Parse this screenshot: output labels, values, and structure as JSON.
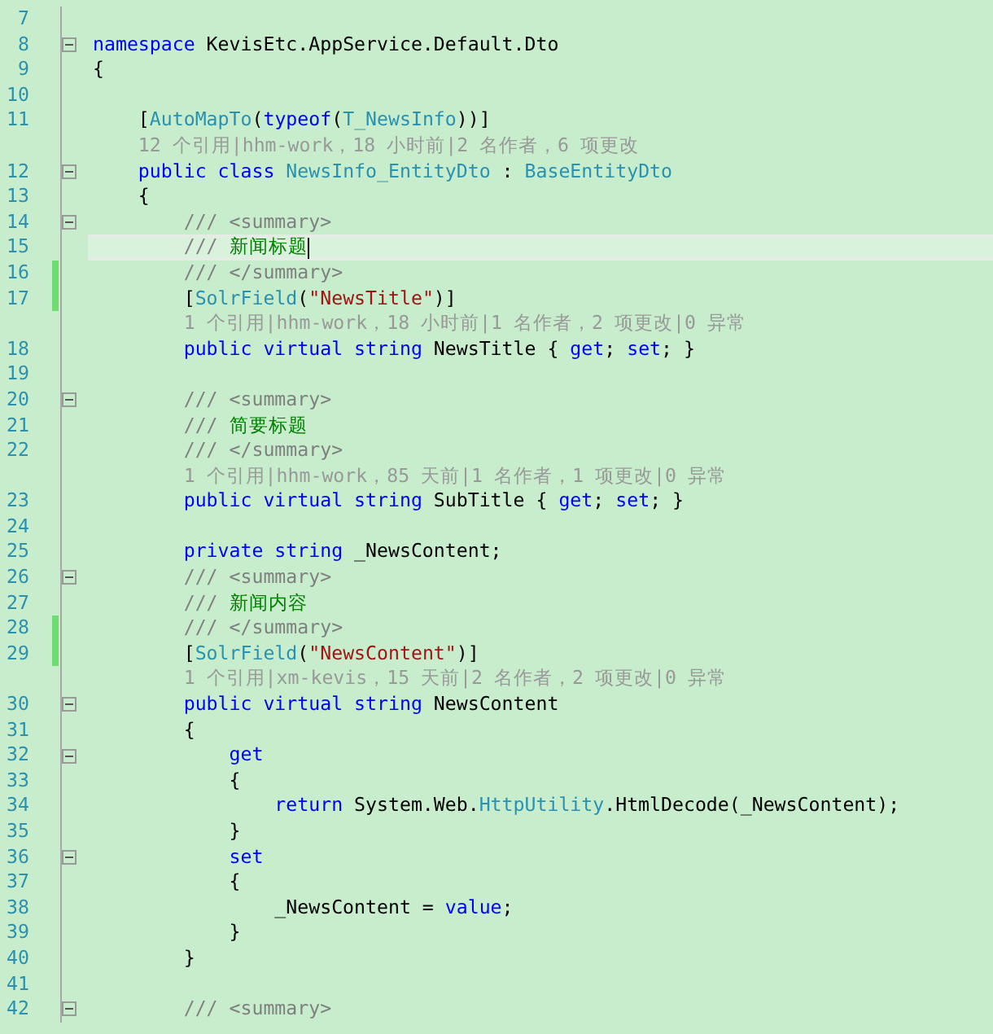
{
  "editor": {
    "lines": [
      {
        "num": "7",
        "kind": "code",
        "fold": false,
        "changed": false,
        "current": false
      },
      {
        "num": "8",
        "kind": "code",
        "fold": true,
        "changed": false,
        "current": false,
        "tokens": [
          {
            "kind": "kw",
            "text": "namespace"
          },
          {
            "kind": "plain",
            "text": " KevisEtc.AppService.Default.Dto"
          }
        ]
      },
      {
        "num": "9",
        "kind": "code",
        "fold": false,
        "changed": false,
        "current": false,
        "tokens": [
          {
            "kind": "plain",
            "text": "{"
          }
        ]
      },
      {
        "num": "10",
        "kind": "code",
        "fold": false,
        "changed": false,
        "current": false
      },
      {
        "num": "11",
        "kind": "code",
        "fold": false,
        "changed": false,
        "current": false,
        "tokens": [
          {
            "kind": "plain",
            "text": "    ["
          },
          {
            "kind": "type",
            "text": "AutoMapTo"
          },
          {
            "kind": "plain",
            "text": "("
          },
          {
            "kind": "kw",
            "text": "typeof"
          },
          {
            "kind": "plain",
            "text": "("
          },
          {
            "kind": "type",
            "text": "T_NewsInfo"
          },
          {
            "kind": "plain",
            "text": "))]"
          }
        ]
      },
      {
        "kind": "lens",
        "text": "    12 个引用|hhm-work，18 小时前|2 名作者，6 项更改"
      },
      {
        "num": "12",
        "kind": "code",
        "fold": true,
        "changed": false,
        "current": false,
        "tokens": [
          {
            "kind": "kw",
            "text": "    public class "
          },
          {
            "kind": "type",
            "text": "NewsInfo_EntityDto"
          },
          {
            "kind": "plain",
            "text": " : "
          },
          {
            "kind": "type",
            "text": "BaseEntityDto"
          }
        ]
      },
      {
        "num": "13",
        "kind": "code",
        "fold": false,
        "changed": false,
        "current": false,
        "tokens": [
          {
            "kind": "plain",
            "text": "    {"
          }
        ]
      },
      {
        "num": "14",
        "kind": "code",
        "fold": true,
        "changed": false,
        "current": false,
        "tokens": [
          {
            "kind": "doc",
            "text": "        /// <summary>"
          }
        ]
      },
      {
        "num": "15",
        "kind": "code",
        "fold": false,
        "changed": false,
        "current": true,
        "tokens": [
          {
            "kind": "doc",
            "text": "        /// "
          },
          {
            "kind": "comment",
            "text": "新闻标题"
          }
        ]
      },
      {
        "num": "16",
        "kind": "code",
        "fold": false,
        "changed": true,
        "current": false,
        "tokens": [
          {
            "kind": "doc",
            "text": "        /// </summary>"
          }
        ]
      },
      {
        "num": "17",
        "kind": "code",
        "fold": false,
        "changed": true,
        "current": false,
        "tokens": [
          {
            "kind": "plain",
            "text": "        ["
          },
          {
            "kind": "type",
            "text": "SolrField"
          },
          {
            "kind": "plain",
            "text": "("
          },
          {
            "kind": "str",
            "text": "\"NewsTitle\""
          },
          {
            "kind": "plain",
            "text": ")]"
          }
        ]
      },
      {
        "kind": "lens",
        "text": "        1 个引用|hhm-work，18 小时前|1 名作者，2 项更改|0 异常"
      },
      {
        "num": "18",
        "kind": "code",
        "fold": false,
        "changed": false,
        "current": false,
        "tokens": [
          {
            "kind": "kw",
            "text": "        public virtual string"
          },
          {
            "kind": "plain",
            "text": " NewsTitle { "
          },
          {
            "kind": "kw",
            "text": "get"
          },
          {
            "kind": "plain",
            "text": "; "
          },
          {
            "kind": "kw",
            "text": "set"
          },
          {
            "kind": "plain",
            "text": "; }"
          }
        ]
      },
      {
        "num": "19",
        "kind": "code",
        "fold": false,
        "changed": false,
        "current": false
      },
      {
        "num": "20",
        "kind": "code",
        "fold": true,
        "changed": false,
        "current": false,
        "tokens": [
          {
            "kind": "doc",
            "text": "        /// <summary>"
          }
        ]
      },
      {
        "num": "21",
        "kind": "code",
        "fold": false,
        "changed": false,
        "current": false,
        "tokens": [
          {
            "kind": "doc",
            "text": "        /// "
          },
          {
            "kind": "comment",
            "text": "简要标题"
          }
        ]
      },
      {
        "num": "22",
        "kind": "code",
        "fold": false,
        "changed": false,
        "current": false,
        "tokens": [
          {
            "kind": "doc",
            "text": "        /// </summary>"
          }
        ]
      },
      {
        "kind": "lens",
        "text": "        1 个引用|hhm-work，85 天前|1 名作者，1 项更改|0 异常"
      },
      {
        "num": "23",
        "kind": "code",
        "fold": false,
        "changed": false,
        "current": false,
        "tokens": [
          {
            "kind": "kw",
            "text": "        public virtual string"
          },
          {
            "kind": "plain",
            "text": " SubTitle { "
          },
          {
            "kind": "kw",
            "text": "get"
          },
          {
            "kind": "plain",
            "text": "; "
          },
          {
            "kind": "kw",
            "text": "set"
          },
          {
            "kind": "plain",
            "text": "; }"
          }
        ]
      },
      {
        "num": "24",
        "kind": "code",
        "fold": false,
        "changed": false,
        "current": false
      },
      {
        "num": "25",
        "kind": "code",
        "fold": false,
        "changed": false,
        "current": false,
        "tokens": [
          {
            "kind": "kw",
            "text": "        private string"
          },
          {
            "kind": "plain",
            "text": " _NewsContent;"
          }
        ]
      },
      {
        "num": "26",
        "kind": "code",
        "fold": true,
        "changed": false,
        "current": false,
        "tokens": [
          {
            "kind": "doc",
            "text": "        /// <summary>"
          }
        ]
      },
      {
        "num": "27",
        "kind": "code",
        "fold": false,
        "changed": false,
        "current": false,
        "tokens": [
          {
            "kind": "doc",
            "text": "        /// "
          },
          {
            "kind": "comment",
            "text": "新闻内容"
          }
        ]
      },
      {
        "num": "28",
        "kind": "code",
        "fold": false,
        "changed": true,
        "current": false,
        "tokens": [
          {
            "kind": "doc",
            "text": "        /// </summary>"
          }
        ]
      },
      {
        "num": "29",
        "kind": "code",
        "fold": false,
        "changed": true,
        "current": false,
        "tokens": [
          {
            "kind": "plain",
            "text": "        ["
          },
          {
            "kind": "type",
            "text": "SolrField"
          },
          {
            "kind": "plain",
            "text": "("
          },
          {
            "kind": "str",
            "text": "\"NewsContent\""
          },
          {
            "kind": "plain",
            "text": ")]"
          }
        ]
      },
      {
        "kind": "lens",
        "text": "        1 个引用|xm-kevis，15 天前|2 名作者，2 项更改|0 异常"
      },
      {
        "num": "30",
        "kind": "code",
        "fold": true,
        "changed": false,
        "current": false,
        "tokens": [
          {
            "kind": "kw",
            "text": "        public virtual string"
          },
          {
            "kind": "plain",
            "text": " NewsContent"
          }
        ]
      },
      {
        "num": "31",
        "kind": "code",
        "fold": false,
        "changed": false,
        "current": false,
        "tokens": [
          {
            "kind": "plain",
            "text": "        {"
          }
        ]
      },
      {
        "num": "32",
        "kind": "code",
        "fold": true,
        "changed": false,
        "current": false,
        "tokens": [
          {
            "kind": "kw",
            "text": "            get"
          }
        ]
      },
      {
        "num": "33",
        "kind": "code",
        "fold": false,
        "changed": false,
        "current": false,
        "tokens": [
          {
            "kind": "plain",
            "text": "            {"
          }
        ]
      },
      {
        "num": "34",
        "kind": "code",
        "fold": false,
        "changed": false,
        "current": false,
        "tokens": [
          {
            "kind": "kw",
            "text": "                return"
          },
          {
            "kind": "plain",
            "text": " System.Web."
          },
          {
            "kind": "type",
            "text": "HttpUtility"
          },
          {
            "kind": "plain",
            "text": ".HtmlDecode(_NewsContent);"
          }
        ]
      },
      {
        "num": "35",
        "kind": "code",
        "fold": false,
        "changed": false,
        "current": false,
        "tokens": [
          {
            "kind": "plain",
            "text": "            }"
          }
        ]
      },
      {
        "num": "36",
        "kind": "code",
        "fold": true,
        "changed": false,
        "current": false,
        "tokens": [
          {
            "kind": "kw",
            "text": "            set"
          }
        ]
      },
      {
        "num": "37",
        "kind": "code",
        "fold": false,
        "changed": false,
        "current": false,
        "tokens": [
          {
            "kind": "plain",
            "text": "            {"
          }
        ]
      },
      {
        "num": "38",
        "kind": "code",
        "fold": false,
        "changed": false,
        "current": false,
        "tokens": [
          {
            "kind": "plain",
            "text": "                _NewsContent = "
          },
          {
            "kind": "kw",
            "text": "value"
          },
          {
            "kind": "plain",
            "text": ";"
          }
        ]
      },
      {
        "num": "39",
        "kind": "code",
        "fold": false,
        "changed": false,
        "current": false,
        "tokens": [
          {
            "kind": "plain",
            "text": "            }"
          }
        ]
      },
      {
        "num": "40",
        "kind": "code",
        "fold": false,
        "changed": false,
        "current": false,
        "tokens": [
          {
            "kind": "plain",
            "text": "        }"
          }
        ]
      },
      {
        "num": "41",
        "kind": "code",
        "fold": false,
        "changed": false,
        "current": false
      },
      {
        "num": "42",
        "kind": "code",
        "fold": true,
        "changed": false,
        "current": false,
        "tokens": [
          {
            "kind": "doc",
            "text": "        /// <summary>"
          }
        ]
      }
    ]
  }
}
